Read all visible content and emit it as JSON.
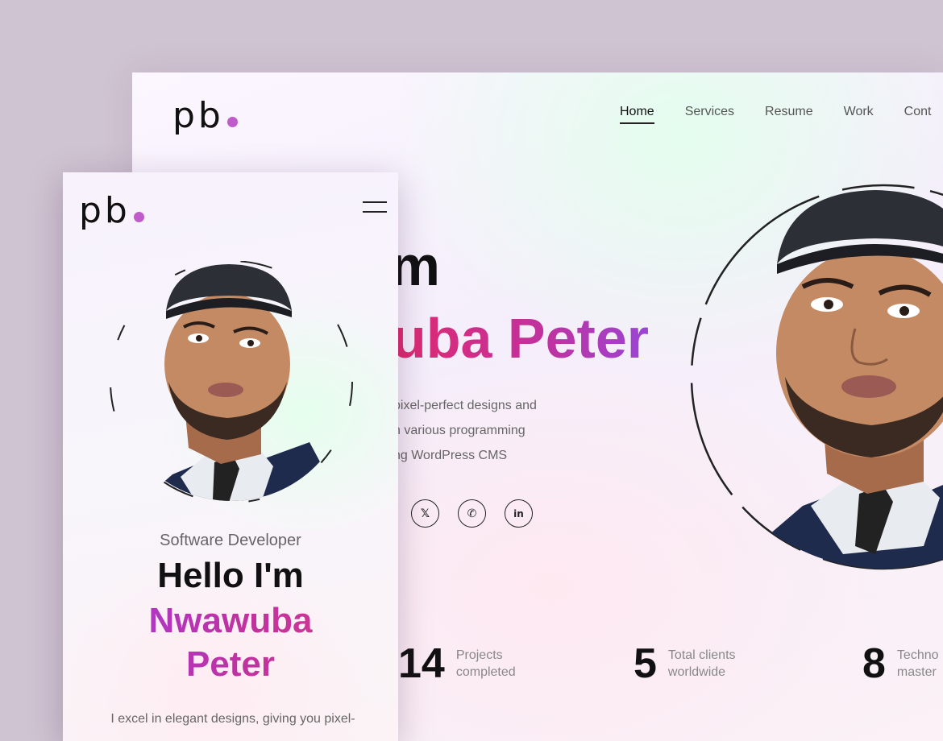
{
  "desktop": {
    "logo": {
      "text": "pb",
      "dot_color": "#c05cc9"
    },
    "nav": [
      {
        "label": "Home",
        "active": true
      },
      {
        "label": "Services",
        "active": false
      },
      {
        "label": "Resume",
        "active": false
      },
      {
        "label": "Work",
        "active": false
      },
      {
        "label": "Cont",
        "active": false
      }
    ],
    "hero": {
      "greeting_fragment": "m",
      "name_fragment": "uba Peter",
      "bio_lines": [
        "pixel-perfect designs and",
        "n various programming",
        "ng WordPress CMS"
      ]
    },
    "socials": [
      {
        "icon": "x-icon",
        "glyph": "𝕏"
      },
      {
        "icon": "whatsapp-icon",
        "glyph": "✆"
      },
      {
        "icon": "linkedin-icon",
        "glyph": "in"
      }
    ],
    "stats": [
      {
        "number": "14",
        "label_line1": "Projects",
        "label_line2": "completed"
      },
      {
        "number": "5",
        "label_line1": "Total clients",
        "label_line2": "worldwide"
      },
      {
        "number": "8",
        "label_line1": "Techno",
        "label_line2": "master"
      }
    ]
  },
  "mobile": {
    "logo": {
      "text": "pb"
    },
    "hero": {
      "role": "Software Developer",
      "greeting": "Hello I'm",
      "name_line1": "Nwawuba",
      "name_line2": "Peter",
      "bio_lines": [
        "I excel in elegant designs, giving you pixel-"
      ]
    }
  },
  "colors": {
    "background": "#cfc4d2",
    "accent_pink": "#e02a6e",
    "accent_purple": "#9a45d6",
    "logo_dot": "#c05cc9"
  }
}
